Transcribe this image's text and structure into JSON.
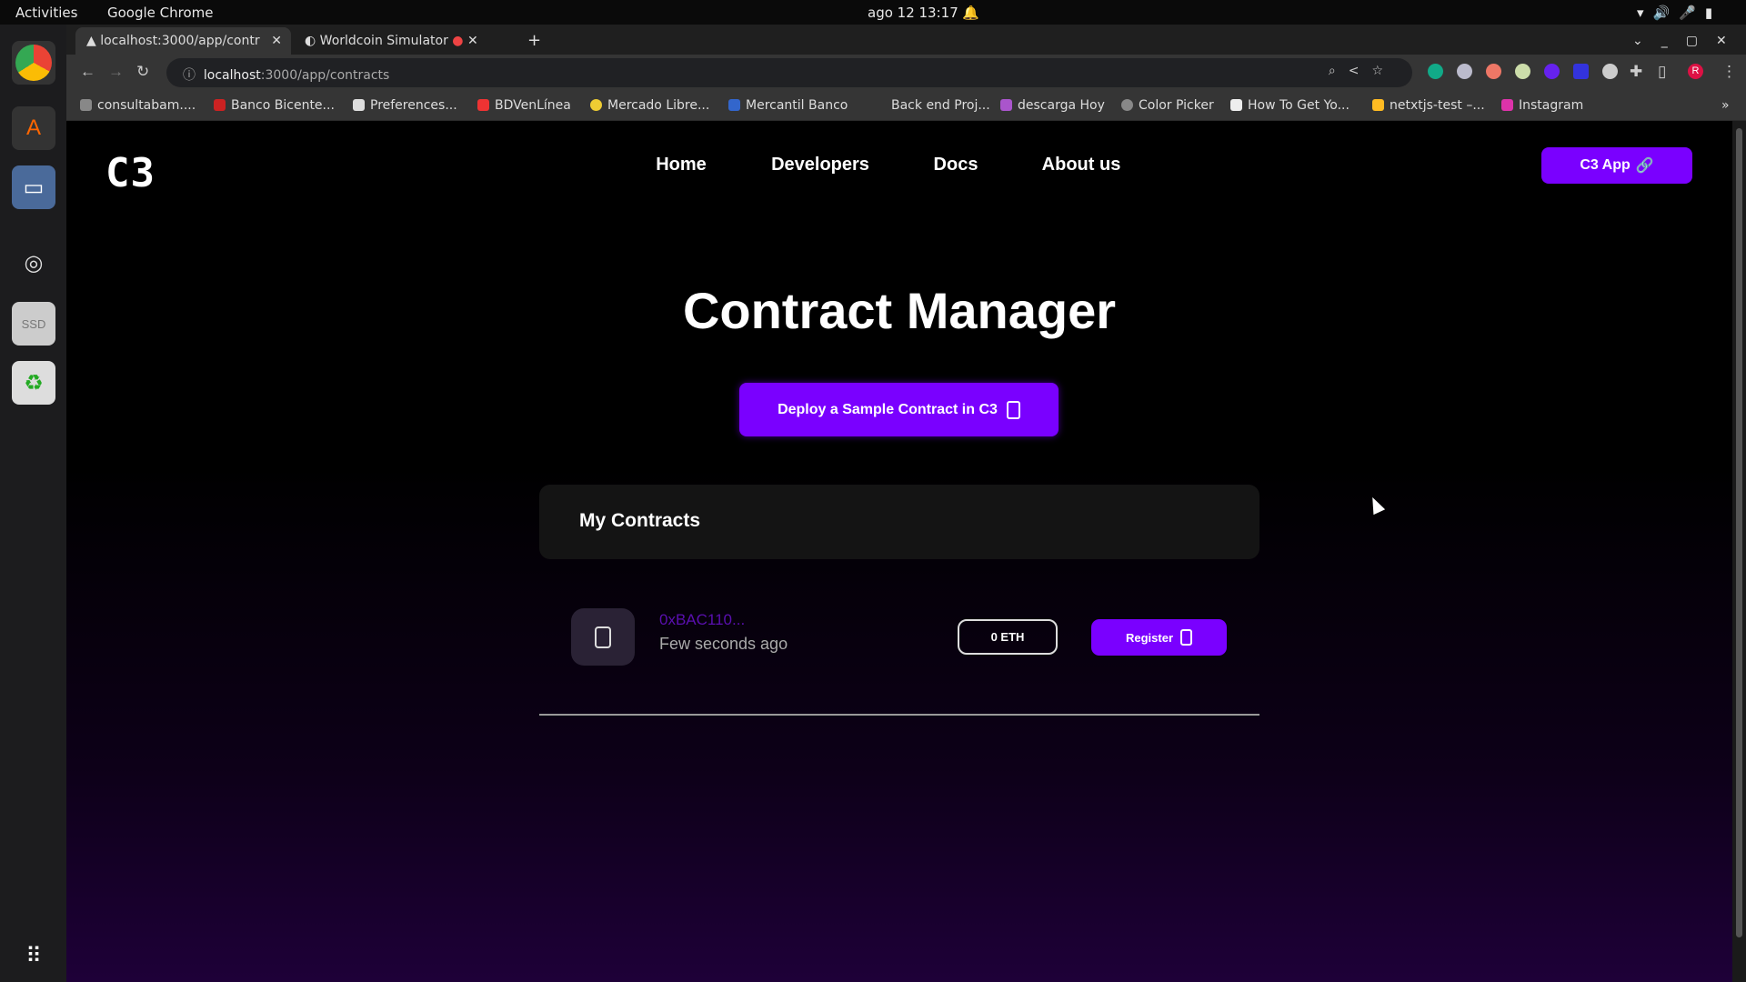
{
  "os": {
    "activities": "Activities",
    "app_name": "Google Chrome",
    "clock": "ago 12  13:17"
  },
  "browser": {
    "tabs": [
      {
        "label": "localhost:3000/app/contr",
        "active": true
      },
      {
        "label": "Worldcoin Simulator",
        "active": false
      }
    ],
    "url_host": "localhost",
    "url_path": ":3000/app/contracts",
    "bookmarks": [
      "consultabam....",
      "Banco Bicente...",
      "Preferences...",
      "BDVenLínea",
      "Mercado Libre...",
      "Mercantil Banco",
      "Back end Proj...",
      "descarga Hoy",
      "Color Picker",
      "How To Get Yo...",
      "netxtjs-test –...",
      "Instagram"
    ],
    "profile_initial": "R"
  },
  "site": {
    "logo": "C3",
    "nav": [
      "Home",
      "Developers",
      "Docs",
      "About us"
    ],
    "app_button": "C3 App",
    "title": "Contract Manager",
    "deploy_button": "Deploy a Sample Contract in C3",
    "my_contracts": "My Contracts",
    "contracts": [
      {
        "address": "0xBAC110...",
        "time": "Few seconds ago",
        "balance": "0 ETH",
        "action": "Register"
      }
    ],
    "accent": "#7a00ff"
  }
}
